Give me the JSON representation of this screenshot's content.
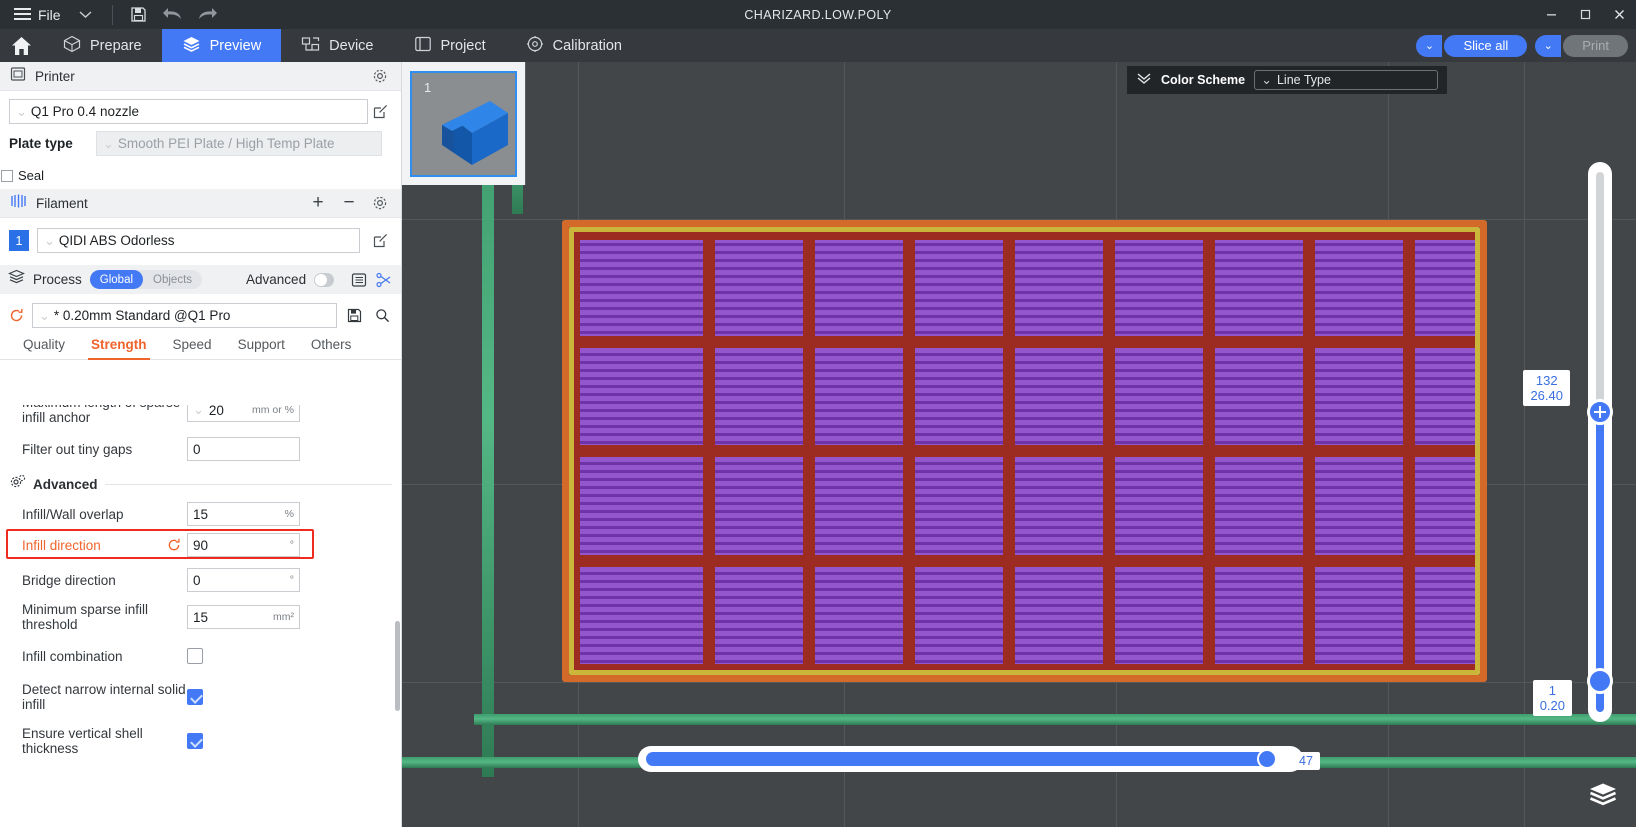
{
  "window": {
    "title": "CHARIZARD.LOW.POLY",
    "file_menu": "File",
    "minimize": "–",
    "maximize": "□",
    "close": "✕"
  },
  "nav": {
    "home_icon": "home-icon",
    "items": [
      {
        "label": "Prepare",
        "icon": "prepare-icon",
        "active": false
      },
      {
        "label": "Preview",
        "icon": "preview-icon",
        "active": true
      },
      {
        "label": "Device",
        "icon": "device-icon",
        "active": false
      },
      {
        "label": "Project",
        "icon": "project-icon",
        "active": false
      },
      {
        "label": "Calibration",
        "icon": "calibration-icon",
        "active": false
      }
    ],
    "slice_all": "Slice all",
    "print": "Print",
    "dropdown_glyph": "⌄"
  },
  "printer": {
    "section_title": "Printer",
    "preset": "Q1 Pro 0.4 nozzle",
    "plate_type_label": "Plate type",
    "plate_type_value": "Smooth PEI Plate / High Temp Plate",
    "seal_label": "Seal",
    "seal_checked": false
  },
  "filament": {
    "section_title": "Filament",
    "add": "+",
    "remove": "−",
    "index": "1",
    "preset": "QIDI ABS Odorless"
  },
  "process": {
    "section_title": "Process",
    "scope_global": "Global",
    "scope_objects": "Objects",
    "advanced_label": "Advanced",
    "advanced_on": false,
    "preset": "* 0.20mm Standard @Q1 Pro",
    "tabs": [
      {
        "label": "Quality",
        "active": false
      },
      {
        "label": "Strength",
        "active": true
      },
      {
        "label": "Speed",
        "active": false
      },
      {
        "label": "Support",
        "active": false
      },
      {
        "label": "Others",
        "active": false
      }
    ]
  },
  "settings": {
    "advanced_header": "Advanced",
    "rows": [
      {
        "label": "Maximum length of sparse infill anchor",
        "value": "20",
        "unit": "mm or %",
        "type": "combo"
      },
      {
        "label": "Filter out tiny gaps",
        "value": "0",
        "unit": "",
        "type": "text"
      },
      {
        "label": "Infill/Wall overlap",
        "value": "15",
        "unit": "%",
        "type": "text"
      },
      {
        "label": "Infill direction",
        "value": "90",
        "unit": "°",
        "type": "text",
        "highlight": true,
        "reset": true
      },
      {
        "label": "Bridge direction",
        "value": "0",
        "unit": "°",
        "type": "text"
      },
      {
        "label": "Minimum sparse infill threshold",
        "value": "15",
        "unit": "mm²",
        "type": "text"
      },
      {
        "label": "Infill combination",
        "value": "",
        "unit": "",
        "type": "checkbox",
        "checked": false
      },
      {
        "label": "Detect narrow internal solid infill",
        "value": "",
        "unit": "",
        "type": "checkbox",
        "checked": true
      },
      {
        "label": "Ensure vertical shell thickness",
        "value": "",
        "unit": "",
        "type": "checkbox",
        "checked": true
      }
    ]
  },
  "viewport": {
    "thumbnail_number": "1",
    "color_scheme_label": "Color Scheme",
    "color_scheme_value": "Line Type",
    "vertical_slider": {
      "top_label_layer": "132",
      "top_label_height": "26.40",
      "bottom_label_layer": "1",
      "bottom_label_height": "0.20"
    },
    "horizontal_slider": {
      "value": "47"
    },
    "layers_icon": "layers-icon"
  },
  "colors": {
    "accent_blue": "#4479f5",
    "accent_orange": "#f0642c",
    "highlight_red": "#ee2b1e",
    "wall_red": "#9c2b21",
    "infill_purple": "#8548c0",
    "skirt_orange": "#d46a2a",
    "brim_yellow": "#c9b63a",
    "support_green": "#4aa87a"
  }
}
